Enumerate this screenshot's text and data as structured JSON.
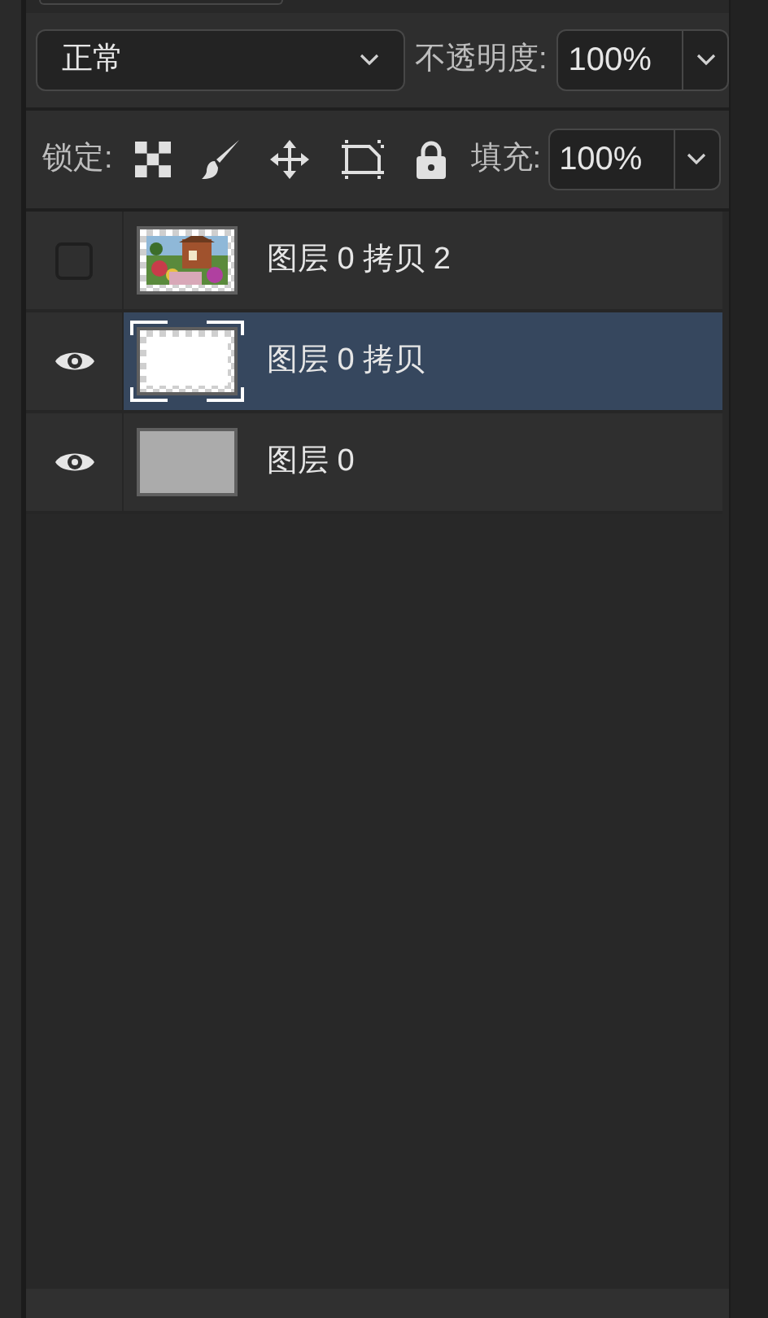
{
  "blend_mode": {
    "value": "正常"
  },
  "opacity": {
    "label": "不透明度:",
    "value": "100%"
  },
  "lock": {
    "label": "锁定:"
  },
  "fill": {
    "label": "填充:",
    "value": "100%"
  },
  "layers": [
    {
      "name": "图层 0 拷贝 2",
      "visible": false,
      "selected": false
    },
    {
      "name": "图层 0 拷贝",
      "visible": true,
      "selected": true,
      "thumbnail": {
        "kind": "white"
      }
    },
    {
      "name": "图层 0",
      "visible": true,
      "selected": false,
      "thumbnail": {
        "kind": "gray"
      }
    }
  ]
}
